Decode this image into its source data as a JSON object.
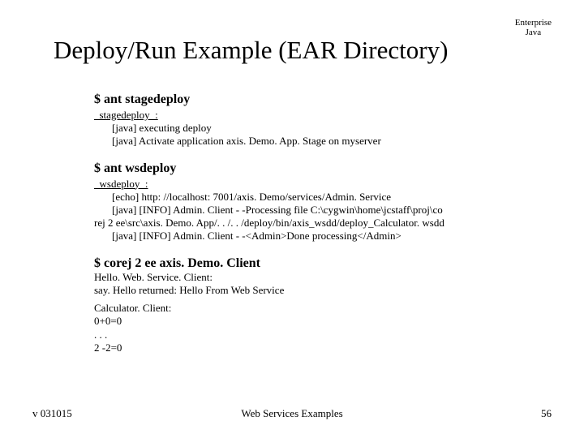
{
  "corner": {
    "line1": "Enterprise",
    "line2": "Java"
  },
  "title": "Deploy/Run Example (EAR Directory)",
  "sections": {
    "s1": {
      "cmd": "$ ant stagedeploy",
      "target": "_stagedeploy_:",
      "l1": "[java] executing deploy",
      "l2": "[java] Activate application axis. Demo. App. Stage on myserver"
    },
    "s2": {
      "cmd": "$ ant wsdeploy",
      "target": "_wsdeploy_:",
      "l1": "[echo] http: //localhost: 7001/axis. Demo/services/Admin. Service",
      "l2": "[java] [INFO] Admin. Client - -Processing file C:\\cygwin\\home\\jcstaff\\proj\\co",
      "l2wrap": "rej 2 ee\\src\\axis. Demo. App/. . /. . /deploy/bin/axis_wsdd/deploy_Calculator. wsdd",
      "l3": "[java] [INFO] Admin. Client - -<Admin>Done processing</Admin>"
    },
    "s3": {
      "cmd": "$ corej 2 ee axis. Demo. Client",
      "l1": "Hello. Web. Service. Client:",
      "l2": "say. Hello returned: Hello From Web Service",
      "l3": "Calculator. Client:",
      "l4": "0+0=0",
      "l5": ". . .",
      "l6": "2 -2=0"
    }
  },
  "footer": {
    "version": "v 031015",
    "center": "Web Services Examples",
    "page": "56"
  }
}
